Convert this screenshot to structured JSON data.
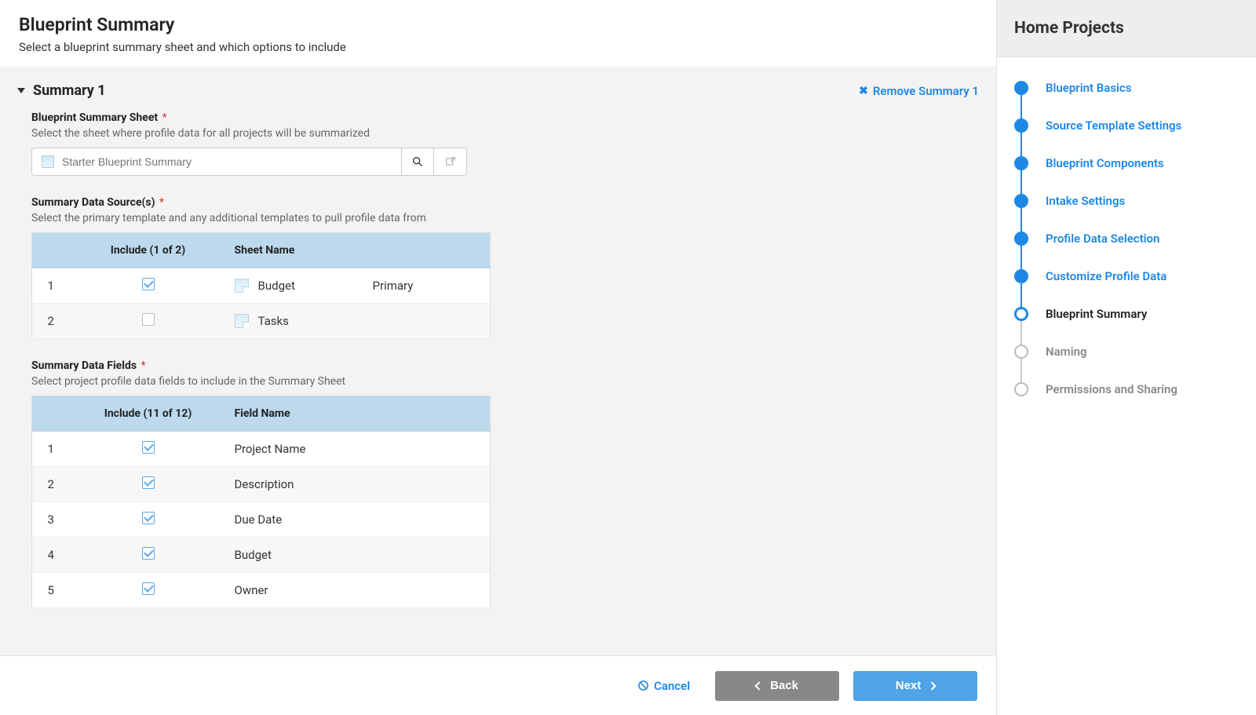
{
  "header": {
    "title": "Blueprint Summary",
    "subtitle": "Select a blueprint summary sheet and which options to include"
  },
  "summary": {
    "panel_title": "Summary 1",
    "remove_label": "Remove Summary 1",
    "sheet": {
      "label": "Blueprint Summary Sheet",
      "help": "Select the sheet where profile data for all projects will be summarized",
      "placeholder": "Starter Blueprint Summary"
    },
    "sources": {
      "label": "Summary Data Source(s)",
      "help": "Select the primary template and any additional templates to pull profile data from",
      "include_header": "Include (1 of 2)",
      "name_header": "Sheet Name",
      "rows": [
        {
          "num": "1",
          "checked": true,
          "name": "Budget",
          "status": "Primary"
        },
        {
          "num": "2",
          "checked": false,
          "name": "Tasks",
          "status": ""
        }
      ]
    },
    "fields": {
      "label": "Summary Data Fields",
      "help": "Select project profile data fields to include in the Summary Sheet",
      "include_header": "Include (11 of 12)",
      "name_header": "Field Name",
      "rows": [
        {
          "num": "1",
          "checked": true,
          "name": "Project Name"
        },
        {
          "num": "2",
          "checked": true,
          "name": "Description"
        },
        {
          "num": "3",
          "checked": true,
          "name": "Due Date"
        },
        {
          "num": "4",
          "checked": true,
          "name": "Budget"
        },
        {
          "num": "5",
          "checked": true,
          "name": "Owner"
        }
      ]
    }
  },
  "footer": {
    "cancel": "Cancel",
    "back": "Back",
    "next": "Next"
  },
  "sidebar": {
    "title": "Home Projects",
    "steps": [
      {
        "label": "Blueprint Basics",
        "state": "done"
      },
      {
        "label": "Source Template Settings",
        "state": "done"
      },
      {
        "label": "Blueprint Components",
        "state": "done"
      },
      {
        "label": "Intake Settings",
        "state": "done"
      },
      {
        "label": "Profile Data Selection",
        "state": "done"
      },
      {
        "label": "Customize Profile Data",
        "state": "done"
      },
      {
        "label": "Blueprint Summary",
        "state": "current"
      },
      {
        "label": "Naming",
        "state": "future"
      },
      {
        "label": "Permissions and Sharing",
        "state": "future"
      }
    ]
  }
}
